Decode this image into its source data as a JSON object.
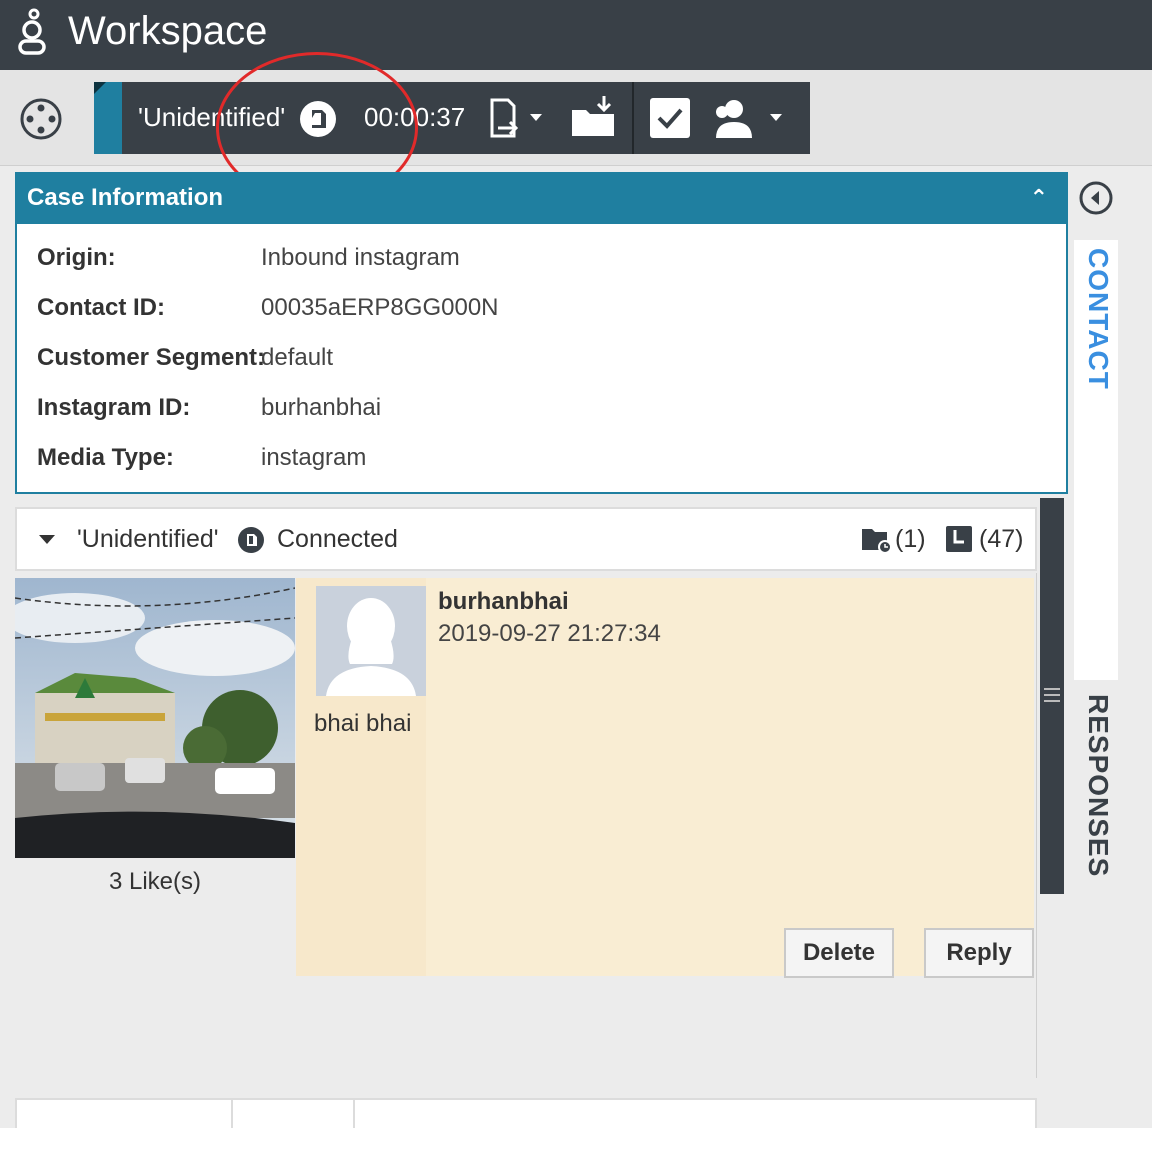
{
  "app": {
    "title": "Workspace"
  },
  "interaction": {
    "name": "'Unidentified'",
    "timer": "00:00:37"
  },
  "case_info": {
    "header": "Case Information",
    "fields": [
      {
        "label": "Origin:",
        "value": "Inbound instagram"
      },
      {
        "label": "Contact ID:",
        "value": "00035aERP8GG000N"
      },
      {
        "label": "Customer Segment:",
        "value": "default"
      },
      {
        "label": "Instagram ID:",
        "value": "burhanbhai"
      },
      {
        "label": "Media Type:",
        "value": "instagram"
      }
    ]
  },
  "side_tabs": {
    "contact": "CONTACT",
    "responses": "RESPONSES"
  },
  "conversation": {
    "name": "'Unidentified'",
    "status": "Connected",
    "folder_count": "(1)",
    "history_count": "(47)"
  },
  "post": {
    "likes": "3 Like(s)"
  },
  "comment": {
    "author": "burhanbhai",
    "timestamp": "2019-09-27 21:27:34",
    "text": "bhai bhai",
    "delete_label": "Delete",
    "reply_label": "Reply"
  },
  "colors": {
    "titlebar": "#394047",
    "accent": "#1f7fa0",
    "comment_bg": "#f9edd3",
    "annotation": "#e12a2a",
    "contact_tab": "#3a8fe0"
  }
}
